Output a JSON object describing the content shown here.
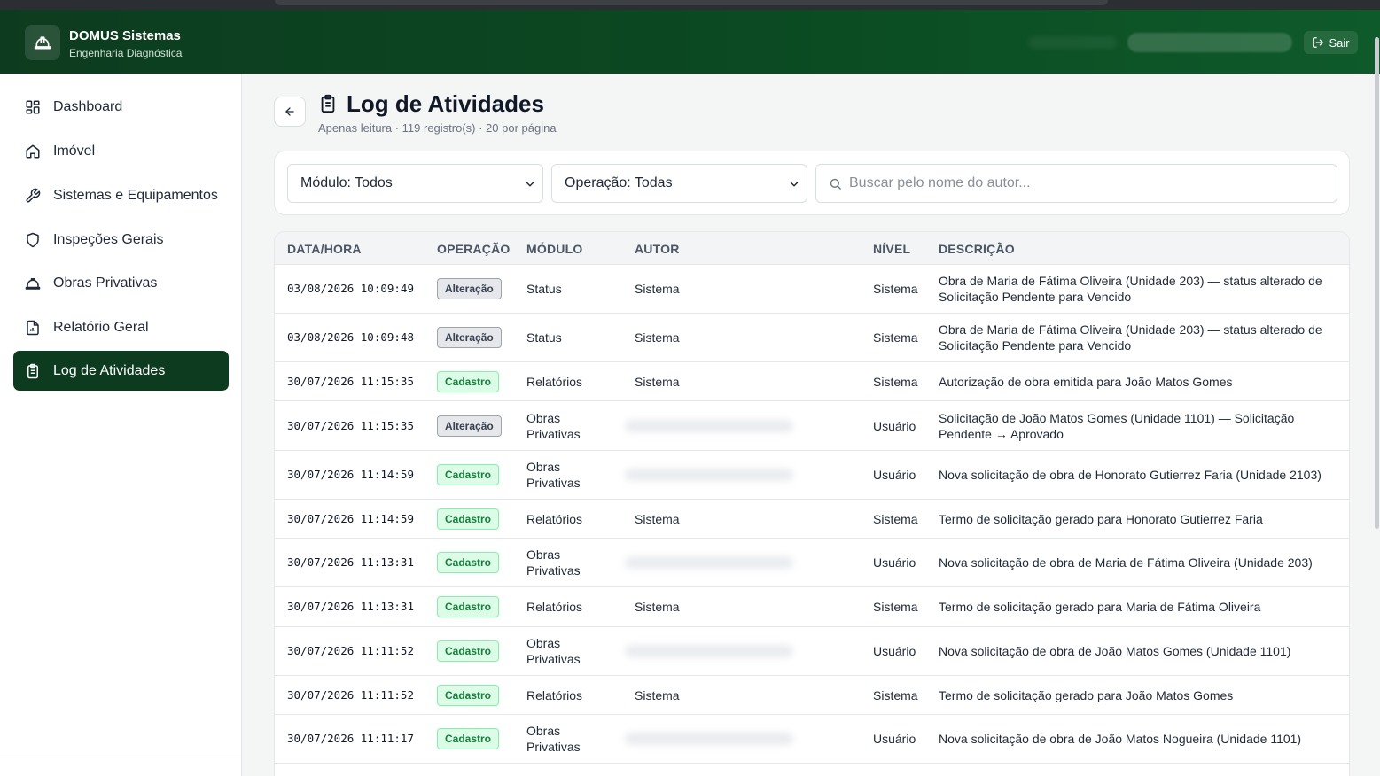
{
  "app": {
    "name": "DOMUS Sistemas",
    "subtitle": "Engenharia Diagnóstica",
    "logout_label": "Sair"
  },
  "sidebar": {
    "items": [
      {
        "label": "Dashboard",
        "icon": "dashboard-icon",
        "active": false
      },
      {
        "label": "Imóvel",
        "icon": "home-icon",
        "active": false
      },
      {
        "label": "Sistemas e Equipamentos",
        "icon": "wrench-icon",
        "active": false
      },
      {
        "label": "Inspeções Gerais",
        "icon": "shield-icon",
        "active": false
      },
      {
        "label": "Obras Privativas",
        "icon": "hardhat-icon",
        "active": false
      },
      {
        "label": "Relatório Geral",
        "icon": "report-icon",
        "active": false
      },
      {
        "label": "Log de Atividades",
        "icon": "clipboard-icon",
        "active": true
      }
    ]
  },
  "page": {
    "title": "Log de Atividades",
    "subtitle": "Apenas leitura · 119 registro(s) · 20 por página"
  },
  "filters": {
    "module_value": "Módulo: Todos",
    "operation_value": "Operação: Todas",
    "search_placeholder": "Buscar pelo nome do autor..."
  },
  "table": {
    "headers": {
      "datetime": "DATA/HORA",
      "operation": "OPERAÇÃO",
      "module": "MÓDULO",
      "author": "AUTOR",
      "level": "NÍVEL",
      "description": "DESCRIÇÃO"
    },
    "rows": [
      {
        "datetime": "03/08/2026 10:09:49",
        "operation": "Alteração",
        "op_type": "alteracao",
        "module": "Status",
        "author": "Sistema",
        "level": "Sistema",
        "description": "Obra de Maria de Fátima Oliveira (Unidade 203) — status alterado de Solicitação Pendente para Vencido"
      },
      {
        "datetime": "03/08/2026 10:09:48",
        "operation": "Alteração",
        "op_type": "alteracao",
        "module": "Status",
        "author": "Sistema",
        "level": "Sistema",
        "description": "Obra de Maria de Fátima Oliveira (Unidade 203) — status alterado de Solicitação Pendente para Vencido"
      },
      {
        "datetime": "30/07/2026 11:15:35",
        "operation": "Cadastro",
        "op_type": "cadastro",
        "module": "Relatórios",
        "author": "Sistema",
        "level": "Sistema",
        "description": "Autorização de obra emitida para João Matos Gomes"
      },
      {
        "datetime": "30/07/2026 11:15:35",
        "operation": "Alteração",
        "op_type": "alteracao",
        "module": "Obras Privativas",
        "author": "",
        "level": "Usuário",
        "description": "Solicitação de João Matos Gomes (Unidade 1101) — Solicitação Pendente → Aprovado"
      },
      {
        "datetime": "30/07/2026 11:14:59",
        "operation": "Cadastro",
        "op_type": "cadastro",
        "module": "Obras Privativas",
        "author": "",
        "level": "Usuário",
        "description": "Nova solicitação de obra de Honorato Gutierrez Faria (Unidade 2103)"
      },
      {
        "datetime": "30/07/2026 11:14:59",
        "operation": "Cadastro",
        "op_type": "cadastro",
        "module": "Relatórios",
        "author": "Sistema",
        "level": "Sistema",
        "description": "Termo de solicitação gerado para Honorato Gutierrez Faria"
      },
      {
        "datetime": "30/07/2026 11:13:31",
        "operation": "Cadastro",
        "op_type": "cadastro",
        "module": "Obras Privativas",
        "author": "",
        "level": "Usuário",
        "description": "Nova solicitação de obra de Maria de Fátima Oliveira (Unidade 203)"
      },
      {
        "datetime": "30/07/2026 11:13:31",
        "operation": "Cadastro",
        "op_type": "cadastro",
        "module": "Relatórios",
        "author": "Sistema",
        "level": "Sistema",
        "description": "Termo de solicitação gerado para Maria de Fátima Oliveira"
      },
      {
        "datetime": "30/07/2026 11:11:52",
        "operation": "Cadastro",
        "op_type": "cadastro",
        "module": "Obras Privativas",
        "author": "",
        "level": "Usuário",
        "description": "Nova solicitação de obra de João Matos Gomes (Unidade 1101)"
      },
      {
        "datetime": "30/07/2026 11:11:52",
        "operation": "Cadastro",
        "op_type": "cadastro",
        "module": "Relatórios",
        "author": "Sistema",
        "level": "Sistema",
        "description": "Termo de solicitação gerado para João Matos Gomes"
      },
      {
        "datetime": "30/07/2026 11:11:17",
        "operation": "Cadastro",
        "op_type": "cadastro",
        "module": "Obras Privativas",
        "author": "",
        "level": "Usuário",
        "description": "Nova solicitação de obra de João Matos Nogueira (Unidade 1101)"
      }
    ]
  },
  "colors": {
    "brand_dark": "#0d3b1f",
    "cadastro_bg": "#dcfce7",
    "cadastro_text": "#15803d",
    "alteracao_bg": "#e5e7eb"
  }
}
